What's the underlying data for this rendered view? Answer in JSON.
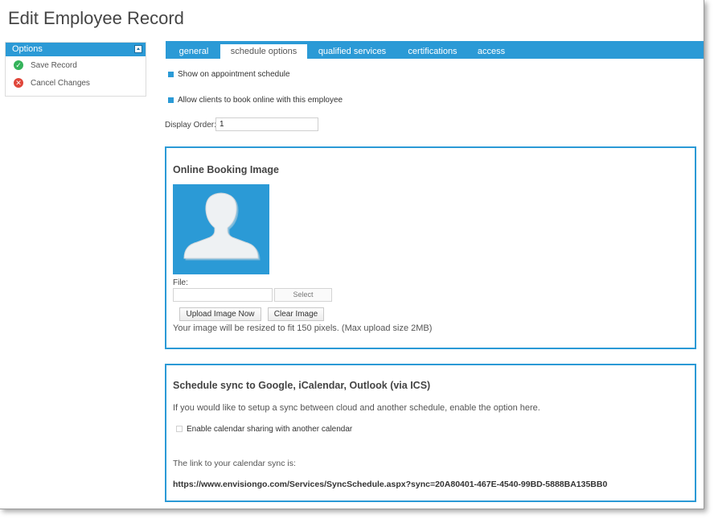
{
  "page": {
    "title": "Edit Employee Record"
  },
  "sidebar": {
    "header": "Options",
    "items": [
      {
        "label": "Save Record",
        "icon": "check-circle-icon"
      },
      {
        "label": "Cancel Changes",
        "icon": "x-circle-icon"
      }
    ]
  },
  "tabs": [
    {
      "label": "general",
      "active": false
    },
    {
      "label": "schedule options",
      "active": true
    },
    {
      "label": "qualified services",
      "active": false
    },
    {
      "label": "certifications",
      "active": false
    },
    {
      "label": "access",
      "active": false
    }
  ],
  "schedule": {
    "show_on_schedule_label": "Show on appointment schedule",
    "allow_online_label": "Allow clients to book online with this employee",
    "display_order_label": "Display Order:",
    "display_order_value": "1"
  },
  "booking_image": {
    "title": "Online Booking Image",
    "file_label": "File:",
    "select_label": "Select",
    "upload_label": "Upload Image Now",
    "clear_label": "Clear Image",
    "note": "Your image will be resized to fit 150 pixels. (Max upload size 2MB)"
  },
  "sync": {
    "title": "Schedule sync to Google, iCalendar, Outlook (via ICS)",
    "description": "If you would like to setup a sync between cloud and another schedule, enable the option here.",
    "enable_label": "Enable calendar sharing with another calendar",
    "link_label": "The link to your calendar sync is:",
    "link_url": "https://www.envisiongo.com/Services/SyncSchedule.aspx?sync=20A80401-467E-4540-99BD-5888BA135BB0"
  },
  "colors": {
    "accent": "#2b9ad6",
    "success": "#35b35b",
    "danger": "#e0463a"
  }
}
